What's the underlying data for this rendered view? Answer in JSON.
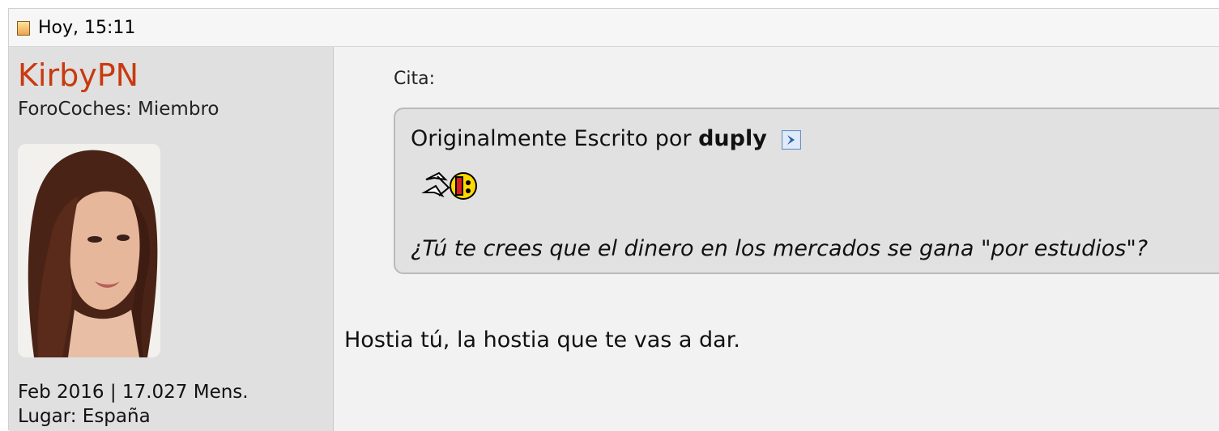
{
  "post": {
    "date": "Hoy, 15:11",
    "icon": "post-icon"
  },
  "user": {
    "name": "KirbyPN",
    "title": "ForoCoches: Miembro",
    "joined_posts": "Feb 2016 | 17.027 Mens.",
    "location": "Lugar: España",
    "colors": {
      "username": "#c83a0f"
    }
  },
  "quote": {
    "label": "Cita:",
    "intro": "Originalmente Escrito por",
    "author": "duply",
    "view_icon": "view-post-icon",
    "smiley": "smiley-icon",
    "text": "¿Tú te crees que el dinero en los mercados se gana \"por estudios\"?"
  },
  "message": {
    "text": "Hostia tú, la hostia que te vas a dar."
  }
}
